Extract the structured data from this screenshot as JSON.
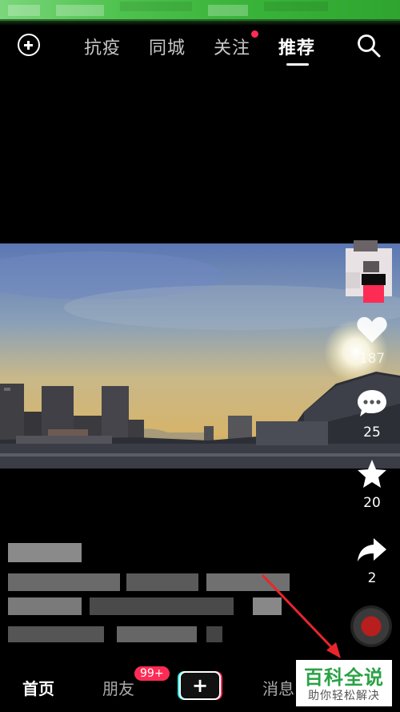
{
  "top_nav": {
    "tabs": [
      {
        "label": "抗疫"
      },
      {
        "label": "同城"
      },
      {
        "label": "关注"
      },
      {
        "label": "推荐"
      }
    ],
    "active_tab": "推荐"
  },
  "actions": {
    "likes": "187",
    "comments": "25",
    "favorites": "20",
    "shares": "2"
  },
  "bottom_nav": {
    "home": "首页",
    "friends": "朋友",
    "friends_badge": "99+",
    "publish": "+",
    "messages": "消息"
  },
  "watermark": {
    "title": "百科全说",
    "subtitle": "助你轻松解决"
  },
  "colors": {
    "accent": "#fe2c55",
    "cyan": "#25f4ee",
    "status_bar": "#3ab43a",
    "watermark_green": "#2ba245"
  }
}
